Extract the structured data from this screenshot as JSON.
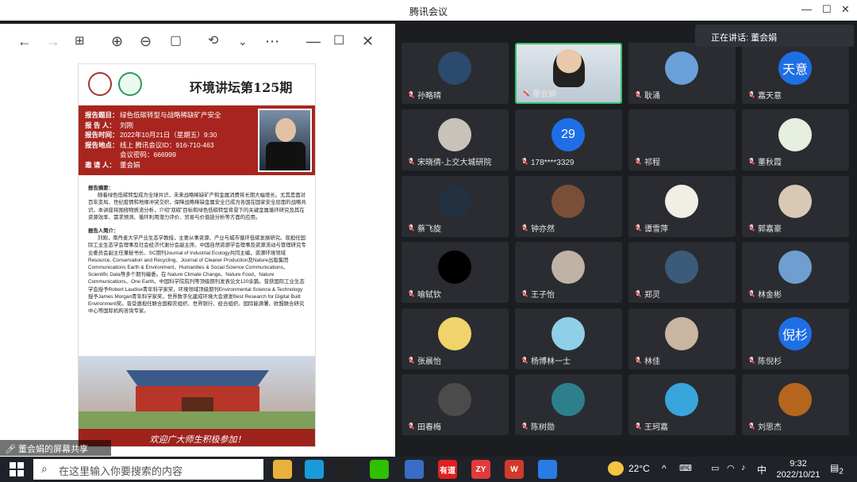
{
  "window": {
    "title": "腾讯会议"
  },
  "speaking": {
    "label": "正在讲话: 董会娟"
  },
  "share": {
    "label": "董会娟的屏幕共享"
  },
  "poster": {
    "heading": "环境讲坛第125期",
    "rows": [
      {
        "k": "报告题目：",
        "v": "绿色低碳转型与战略稀缺矿产安全"
      },
      {
        "k": "报 告 人：",
        "v": "刘刚"
      },
      {
        "k": "报告时间：",
        "v": "2022年10月21日（星期五）9:30"
      },
      {
        "k": "报告地点：",
        "v": "线上 腾讯会议ID：916-710-463"
      },
      {
        "k": "",
        "v": "会议密码：666999"
      },
      {
        "k": "邀 请 人：",
        "v": "董会娟"
      }
    ],
    "abstract_title": "报告摘要：",
    "abstract": "随着绿色低碳转型成为全球共识，未来战略稀缺矿产和金属消费将长期大幅增长。尤其是面对百年变局、世纪疫情和地缘冲突交织，保障战略稀缺金属安全已成为各国在国家安全层面的战略共识。本讲座将围绕物质流分析，介绍“双碳”目标和绿色低碳转型背景下的关键金属循环研究及其在资源效率、需求预测、循环利用潜力评价、贸易与价值链分析等方面的应用。",
    "bio_title": "报告人简介：",
    "bio": "刘刚，南丹麦大学产业生态学教授，主要从事资源、产业与城市循环低碳发展研究。现担任国际工业生态学会理事及社会经济代谢分会副主席、中国自然资源学会理事及资源流动与管理研究专业委员会副主任兼秘书长、SC期刊Journal of Industrial Ecology共同主编，资源环境领域Resource, Conservation and Recycling、Journal of Cleaner Production及Nature出版集团Communications Earth & Environment、Humanities & Social Science Communications、Scientific Data等多个期刊编委。在 Nature Climate Change、Nature Food、Nature Communications、One Earth、中国科学院院刊等顶级期刊发表论文120余篇。曾获国际工业生态学会授予Robert Laudise青年科学家奖，环境领域顶级期刊Environmental Science & Technology授予James Morgan青年科学家奖，世界数字化建成环境大会颁发Best Research for Digital Built Environment奖。曾受邀担任联合国粮农组织、世界银行、经合组织、国际能源署、欧盟联合研究中心等国际机构咨询专家。",
    "footer": "欢迎广大师生积极参加！"
  },
  "participants": [
    {
      "name": "孙略晴",
      "avatar": "photo",
      "color": "#2b4a6e"
    },
    {
      "name": "董会娟",
      "avatar": "video",
      "color": "#cfd8e0"
    },
    {
      "name": "耿涌",
      "avatar": "photo",
      "color": "#6aa0d8"
    },
    {
      "name": "嘉天意",
      "avatar": "text",
      "text": "天意",
      "color": "#1e6fe6"
    },
    {
      "name": "宋晓倩-上交大城研院",
      "avatar": "photo",
      "color": "#c9c2ba"
    },
    {
      "name": "178****3329",
      "avatar": "text",
      "text": "29",
      "color": "#1e6fe6"
    },
    {
      "name": "祁程",
      "avatar": "none",
      "color": "#2a2c31"
    },
    {
      "name": "董秋霞",
      "avatar": "photo",
      "color": "#e6efe0"
    },
    {
      "name": "蔡飞旋",
      "avatar": "photo",
      "color": "#223040"
    },
    {
      "name": "钟亦然",
      "avatar": "photo",
      "color": "#7a4f3a"
    },
    {
      "name": "谭雪萍",
      "avatar": "photo",
      "color": "#f1eee6"
    },
    {
      "name": "郭嘉豪",
      "avatar": "photo",
      "color": "#d8c8b4"
    },
    {
      "name": "喻轼钦",
      "avatar": "photo",
      "color": "#000000"
    },
    {
      "name": "王子怡",
      "avatar": "photo",
      "color": "#bfb3a5"
    },
    {
      "name": "郑灵",
      "avatar": "photo",
      "color": "#3c5a7a"
    },
    {
      "name": "林金彬",
      "avatar": "photo",
      "color": "#6f9fd0"
    },
    {
      "name": "张晨怡",
      "avatar": "photo",
      "color": "#f0d36a"
    },
    {
      "name": "杨博林一士",
      "avatar": "photo",
      "color": "#8fd0e8"
    },
    {
      "name": "林佳",
      "avatar": "photo",
      "color": "#c9b6a0"
    },
    {
      "name": "陈倪杉",
      "avatar": "text",
      "text": "倪杉",
      "color": "#1e6fe6"
    },
    {
      "name": "田春梅",
      "avatar": "photo",
      "color": "#4b4b4b"
    },
    {
      "name": "陈树勋",
      "avatar": "photo",
      "color": "#2e7f8c"
    },
    {
      "name": "王珂嘉",
      "avatar": "photo",
      "color": "#3aa5dc"
    },
    {
      "name": "刘思杰",
      "avatar": "photo",
      "color": "#b5651d"
    }
  ],
  "taskbar": {
    "search_placeholder": "在这里输入你要搜索的内容",
    "weather": "22°C",
    "ime": "中",
    "time": "9:32",
    "date": "2022/10/21",
    "notifications": "2",
    "apps": [
      {
        "name": "file-explorer-icon",
        "label": "",
        "color": "#e8b23a"
      },
      {
        "name": "edge-icon",
        "label": "",
        "color": "#1a9ad9"
      },
      {
        "name": "qq-icon",
        "label": "",
        "color": "#222"
      },
      {
        "name": "wechat-icon",
        "label": "",
        "color": "#2dc100"
      },
      {
        "name": "paint-icon",
        "label": "",
        "color": "#3a6cc6"
      },
      {
        "name": "youdao-icon",
        "label": "有道",
        "color": "#e21e1e"
      },
      {
        "name": "zy-icon",
        "label": "ZY",
        "color": "#e23a3a"
      },
      {
        "name": "wps-icon",
        "label": "W",
        "color": "#d13a2a"
      },
      {
        "name": "tencent-meeting-icon",
        "label": "",
        "color": "#2a7be6"
      }
    ]
  }
}
